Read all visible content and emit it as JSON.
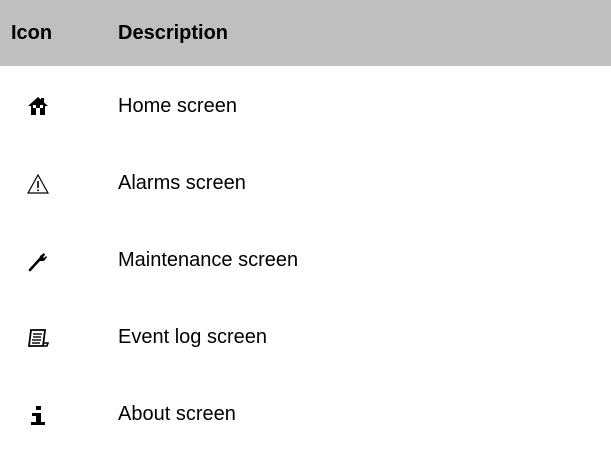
{
  "table": {
    "header": {
      "icon": "Icon",
      "description": "Description"
    },
    "rows": [
      {
        "icon": "home-icon",
        "label": "Home screen"
      },
      {
        "icon": "warning-icon",
        "label": "Alarms screen"
      },
      {
        "icon": "wrench-icon",
        "label": "Maintenance screen"
      },
      {
        "icon": "log-scroll-icon",
        "label": "Event log screen"
      },
      {
        "icon": "info-icon",
        "label": "About screen"
      }
    ]
  },
  "colors": {
    "header_background": "#bfbfbf",
    "text": "#000000"
  }
}
